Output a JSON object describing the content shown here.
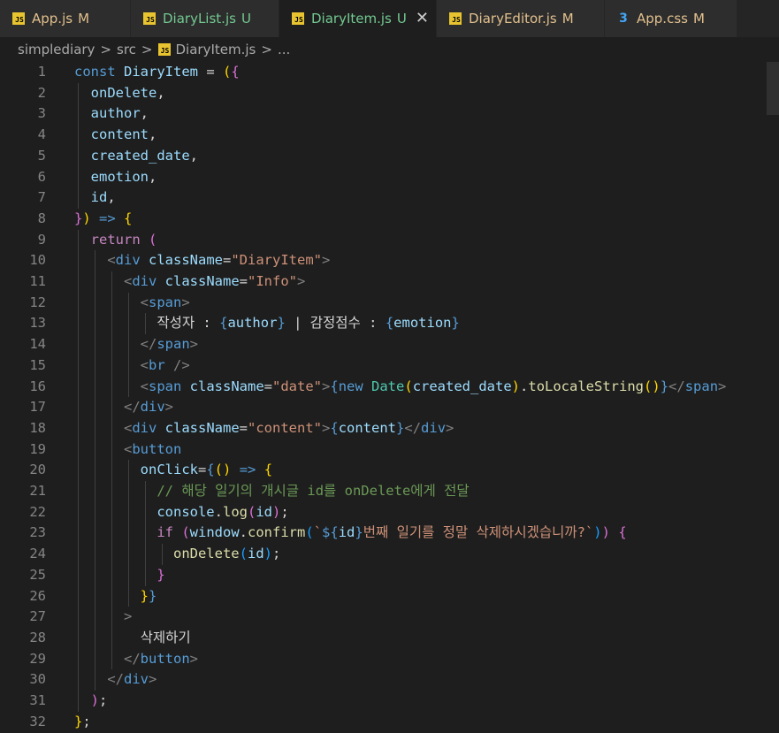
{
  "colors": {
    "keyword": "#569cd6",
    "control": "#c586c0",
    "variable": "#9cdcfe",
    "function": "#dcdcaa",
    "class": "#4ec9b0",
    "string": "#ce9178",
    "comment": "#6a9955",
    "punct": "#d4d4d4",
    "tag_bracket": "#808080",
    "brace_gold": "#ffd700",
    "brace_violet": "#da70d6",
    "brace_blue": "#179fff",
    "modified": "#e2c08d",
    "untracked": "#73c991",
    "crumb": "#a9a9a9"
  },
  "tabs": [
    {
      "name": "App.js",
      "badge": "M",
      "icon": "js-file-icon",
      "active": false,
      "status": "modified"
    },
    {
      "name": "DiaryList.js",
      "badge": "U",
      "icon": "js-file-icon",
      "active": false,
      "status": "untracked"
    },
    {
      "name": "DiaryItem.js",
      "badge": "U",
      "icon": "js-file-icon",
      "active": true,
      "status": "untracked",
      "close": "✕"
    },
    {
      "name": "DiaryEditor.js",
      "badge": "M",
      "icon": "js-file-icon",
      "active": false,
      "status": "modified"
    },
    {
      "name": "App.css",
      "badge": "M",
      "icon": "css-file-icon",
      "active": false,
      "status": "modified"
    }
  ],
  "breadcrumb": {
    "folder1": "simplediary",
    "folder2": "src",
    "file": "DiaryItem.js",
    "separator": ">",
    "more": "..."
  },
  "code_lines": [
    {
      "n": 1,
      "tokens": [
        [
          "const ",
          "keyword"
        ],
        [
          "DiaryItem",
          "variable"
        ],
        [
          " = ",
          "punct"
        ],
        [
          "(",
          "brace_gold"
        ],
        [
          "{",
          "brace_violet"
        ]
      ]
    },
    {
      "n": 2,
      "tokens": [
        [
          "  onDelete",
          "variable"
        ],
        [
          ",",
          "punct"
        ]
      ]
    },
    {
      "n": 3,
      "tokens": [
        [
          "  author",
          "variable"
        ],
        [
          ",",
          "punct"
        ]
      ]
    },
    {
      "n": 4,
      "tokens": [
        [
          "  content",
          "variable"
        ],
        [
          ",",
          "punct"
        ]
      ]
    },
    {
      "n": 5,
      "tokens": [
        [
          "  created_date",
          "variable"
        ],
        [
          ",",
          "punct"
        ]
      ]
    },
    {
      "n": 6,
      "tokens": [
        [
          "  emotion",
          "variable"
        ],
        [
          ",",
          "punct"
        ]
      ]
    },
    {
      "n": 7,
      "tokens": [
        [
          "  id",
          "variable"
        ],
        [
          ",",
          "punct"
        ]
      ]
    },
    {
      "n": 8,
      "tokens": [
        [
          "}",
          "brace_violet"
        ],
        [
          ")",
          "brace_gold"
        ],
        [
          " ",
          "punct"
        ],
        [
          "=>",
          "keyword"
        ],
        [
          " ",
          "punct"
        ],
        [
          "{",
          "brace_gold"
        ]
      ]
    },
    {
      "n": 9,
      "tokens": [
        [
          "  return ",
          "control"
        ],
        [
          "(",
          "brace_violet"
        ]
      ]
    },
    {
      "n": 10,
      "tokens": [
        [
          "    <",
          "tag_bracket"
        ],
        [
          "div",
          "keyword"
        ],
        [
          " className",
          "variable"
        ],
        [
          "=",
          "punct"
        ],
        [
          "\"DiaryItem\"",
          "string"
        ],
        [
          ">",
          "tag_bracket"
        ]
      ]
    },
    {
      "n": 11,
      "tokens": [
        [
          "      <",
          "tag_bracket"
        ],
        [
          "div",
          "keyword"
        ],
        [
          " className",
          "variable"
        ],
        [
          "=",
          "punct"
        ],
        [
          "\"Info\"",
          "string"
        ],
        [
          ">",
          "tag_bracket"
        ]
      ]
    },
    {
      "n": 12,
      "tokens": [
        [
          "        <",
          "tag_bracket"
        ],
        [
          "span",
          "keyword"
        ],
        [
          ">",
          "tag_bracket"
        ]
      ]
    },
    {
      "n": 13,
      "tokens": [
        [
          "          작성자 : ",
          "punct"
        ],
        [
          "{",
          "keyword"
        ],
        [
          "author",
          "variable"
        ],
        [
          "}",
          "keyword"
        ],
        [
          " | 감정점수 : ",
          "punct"
        ],
        [
          "{",
          "keyword"
        ],
        [
          "emotion",
          "variable"
        ],
        [
          "}",
          "keyword"
        ]
      ]
    },
    {
      "n": 14,
      "tokens": [
        [
          "        </",
          "tag_bracket"
        ],
        [
          "span",
          "keyword"
        ],
        [
          ">",
          "tag_bracket"
        ]
      ]
    },
    {
      "n": 15,
      "tokens": [
        [
          "        <",
          "tag_bracket"
        ],
        [
          "br",
          "keyword"
        ],
        [
          " />",
          "tag_bracket"
        ]
      ]
    },
    {
      "n": 16,
      "tokens": [
        [
          "        <",
          "tag_bracket"
        ],
        [
          "span",
          "keyword"
        ],
        [
          " className",
          "variable"
        ],
        [
          "=",
          "punct"
        ],
        [
          "\"date\"",
          "string"
        ],
        [
          ">",
          "tag_bracket"
        ],
        [
          "{",
          "keyword"
        ],
        [
          "new ",
          "keyword"
        ],
        [
          "Date",
          "class"
        ],
        [
          "(",
          "brace_gold"
        ],
        [
          "created_date",
          "variable"
        ],
        [
          ")",
          "brace_gold"
        ],
        [
          ".",
          "punct"
        ],
        [
          "toLocaleString",
          "function"
        ],
        [
          "()",
          "brace_gold"
        ],
        [
          "}",
          "keyword"
        ],
        [
          "</",
          "tag_bracket"
        ],
        [
          "span",
          "keyword"
        ],
        [
          ">",
          "tag_bracket"
        ]
      ]
    },
    {
      "n": 17,
      "tokens": [
        [
          "      </",
          "tag_bracket"
        ],
        [
          "div",
          "keyword"
        ],
        [
          ">",
          "tag_bracket"
        ]
      ]
    },
    {
      "n": 18,
      "tokens": [
        [
          "      <",
          "tag_bracket"
        ],
        [
          "div",
          "keyword"
        ],
        [
          " className",
          "variable"
        ],
        [
          "=",
          "punct"
        ],
        [
          "\"content\"",
          "string"
        ],
        [
          ">",
          "tag_bracket"
        ],
        [
          "{",
          "keyword"
        ],
        [
          "content",
          "variable"
        ],
        [
          "}",
          "keyword"
        ],
        [
          "</",
          "tag_bracket"
        ],
        [
          "div",
          "keyword"
        ],
        [
          ">",
          "tag_bracket"
        ]
      ]
    },
    {
      "n": 19,
      "tokens": [
        [
          "      <",
          "tag_bracket"
        ],
        [
          "button",
          "keyword"
        ]
      ]
    },
    {
      "n": 20,
      "tokens": [
        [
          "        onClick",
          "variable"
        ],
        [
          "=",
          "punct"
        ],
        [
          "{",
          "keyword"
        ],
        [
          "()",
          "brace_gold"
        ],
        [
          " ",
          "punct"
        ],
        [
          "=>",
          "keyword"
        ],
        [
          " ",
          "punct"
        ],
        [
          "{",
          "brace_gold"
        ]
      ]
    },
    {
      "n": 21,
      "tokens": [
        [
          "          // 해당 일기의 개시글 id를 onDelete에게 전달",
          "comment"
        ]
      ]
    },
    {
      "n": 22,
      "tokens": [
        [
          "          console",
          "variable"
        ],
        [
          ".",
          "punct"
        ],
        [
          "log",
          "function"
        ],
        [
          "(",
          "brace_violet"
        ],
        [
          "id",
          "variable"
        ],
        [
          ")",
          "brace_violet"
        ],
        [
          ";",
          "punct"
        ]
      ]
    },
    {
      "n": 23,
      "tokens": [
        [
          "          if ",
          "control"
        ],
        [
          "(",
          "brace_violet"
        ],
        [
          "window",
          "variable"
        ],
        [
          ".",
          "punct"
        ],
        [
          "confirm",
          "function"
        ],
        [
          "(",
          "brace_blue"
        ],
        [
          "`",
          "string"
        ],
        [
          "${",
          "keyword"
        ],
        [
          "id",
          "variable"
        ],
        [
          "}",
          "keyword"
        ],
        [
          "번째 일기를 정말 삭제하시겠습니까?`",
          "string"
        ],
        [
          ")",
          "brace_blue"
        ],
        [
          ")",
          "brace_violet"
        ],
        [
          " ",
          "punct"
        ],
        [
          "{",
          "brace_violet"
        ]
      ]
    },
    {
      "n": 24,
      "tokens": [
        [
          "            onDelete",
          "function"
        ],
        [
          "(",
          "brace_blue"
        ],
        [
          "id",
          "variable"
        ],
        [
          ")",
          "brace_blue"
        ],
        [
          ";",
          "punct"
        ]
      ]
    },
    {
      "n": 25,
      "tokens": [
        [
          "          }",
          "brace_violet"
        ]
      ]
    },
    {
      "n": 26,
      "tokens": [
        [
          "        }",
          "brace_gold"
        ],
        [
          "}",
          "keyword"
        ]
      ]
    },
    {
      "n": 27,
      "tokens": [
        [
          "      >",
          "tag_bracket"
        ]
      ]
    },
    {
      "n": 28,
      "tokens": [
        [
          "        삭제하기",
          "punct"
        ]
      ]
    },
    {
      "n": 29,
      "tokens": [
        [
          "      </",
          "tag_bracket"
        ],
        [
          "button",
          "keyword"
        ],
        [
          ">",
          "tag_bracket"
        ]
      ]
    },
    {
      "n": 30,
      "tokens": [
        [
          "    </",
          "tag_bracket"
        ],
        [
          "div",
          "keyword"
        ],
        [
          ">",
          "tag_bracket"
        ]
      ]
    },
    {
      "n": 31,
      "tokens": [
        [
          "  ",
          "punct"
        ],
        [
          ")",
          "brace_violet"
        ],
        [
          ";",
          "punct"
        ]
      ]
    },
    {
      "n": 32,
      "tokens": [
        [
          "}",
          "brace_gold"
        ],
        [
          ";",
          "punct"
        ]
      ]
    }
  ]
}
